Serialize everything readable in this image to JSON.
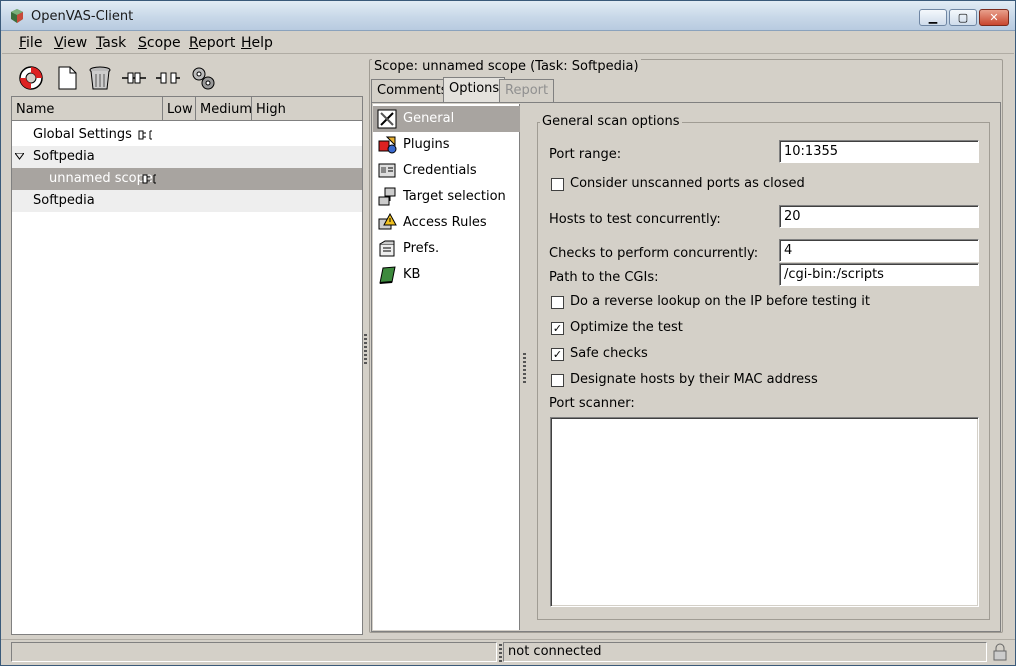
{
  "window": {
    "title": "OpenVAS-Client"
  },
  "menu": [
    {
      "label": "File"
    },
    {
      "label": "View"
    },
    {
      "label": "Task"
    },
    {
      "label": "Scope"
    },
    {
      "label": "Report"
    },
    {
      "label": "Help"
    }
  ],
  "tree": {
    "columns": [
      "Name",
      "Low",
      "Medium",
      "High"
    ],
    "rows": [
      {
        "label": "Global Settings"
      },
      {
        "label": "Softpedia"
      },
      {
        "label": "unnamed scope"
      },
      {
        "label": "Softpedia"
      }
    ]
  },
  "scope": {
    "title": "Scope: unnamed scope (Task: Softpedia)",
    "tabs": [
      "Comments",
      "Options",
      "Report"
    ],
    "active_tab": "Options"
  },
  "categories": [
    "General",
    "Plugins",
    "Credentials",
    "Target selection",
    "Access Rules",
    "Prefs.",
    "KB"
  ],
  "general": {
    "title": "General scan options",
    "port_range_label": "Port range:",
    "port_range": "10:1355",
    "unscanned_label": "Consider unscanned ports as closed",
    "hosts_label": "Hosts to test concurrently:",
    "hosts": "20",
    "checks_label": "Checks to perform concurrently:",
    "checks": "4",
    "cgi_label": "Path to the CGIs:",
    "cgi": "/cgi-bin:/scripts",
    "reverse_label": "Do a reverse lookup on the IP before testing it",
    "optimize_label": "Optimize the test",
    "safe_label": "Safe checks",
    "mac_label": "Designate hosts by their MAC address",
    "port_scanner_label": "Port scanner:",
    "checked": {
      "unscanned": false,
      "reverse": false,
      "optimize": true,
      "safe": true,
      "mac": false
    }
  },
  "status": {
    "connection": "not connected"
  }
}
